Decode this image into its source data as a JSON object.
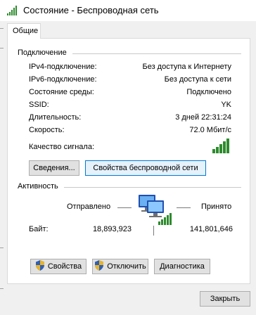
{
  "window": {
    "title": "Состояние - Беспроводная сеть",
    "icon": "wireless-signal-icon"
  },
  "tabs": [
    {
      "label": "Общие"
    }
  ],
  "connection": {
    "group_label": "Подключение",
    "rows": [
      {
        "label": "IPv4-подключение:",
        "value": "Без доступа к Интернету"
      },
      {
        "label": "IPv6-подключение:",
        "value": "Без доступа к сети"
      },
      {
        "label": "Состояние среды:",
        "value": "Подключено"
      },
      {
        "label": "SSID:",
        "value": "YK"
      },
      {
        "label": "Длительность:",
        "value": "3 дней 22:31:24"
      },
      {
        "label": "Скорость:",
        "value": "72.0 Мбит/с"
      }
    ],
    "signal_label": "Качество сигнала:",
    "signal_bars_filled": 5,
    "signal_bars_total": 5,
    "details_button": "Сведения...",
    "wireless_props_button": "Свойства беспроводной сети"
  },
  "activity": {
    "group_label": "Активность",
    "sent_label": "Отправлено",
    "received_label": "Принято",
    "bytes_label": "Байт:",
    "bytes_sent": "18,893,923",
    "bytes_received": "141,801,646",
    "icon": "network-computers-icon"
  },
  "actions": {
    "properties_button": "Свойства",
    "disable_button": "Отключить",
    "diagnose_button": "Диагностика",
    "shield_icon": "uac-shield-icon"
  },
  "footer": {
    "close_button": "Закрыть"
  },
  "colors": {
    "accent": "#0078d7",
    "signal_green": "#2e8b2e",
    "button_bg": "#e1e1e1",
    "shield_blue": "#2f5fb3",
    "shield_gold": "#e8b42a"
  }
}
